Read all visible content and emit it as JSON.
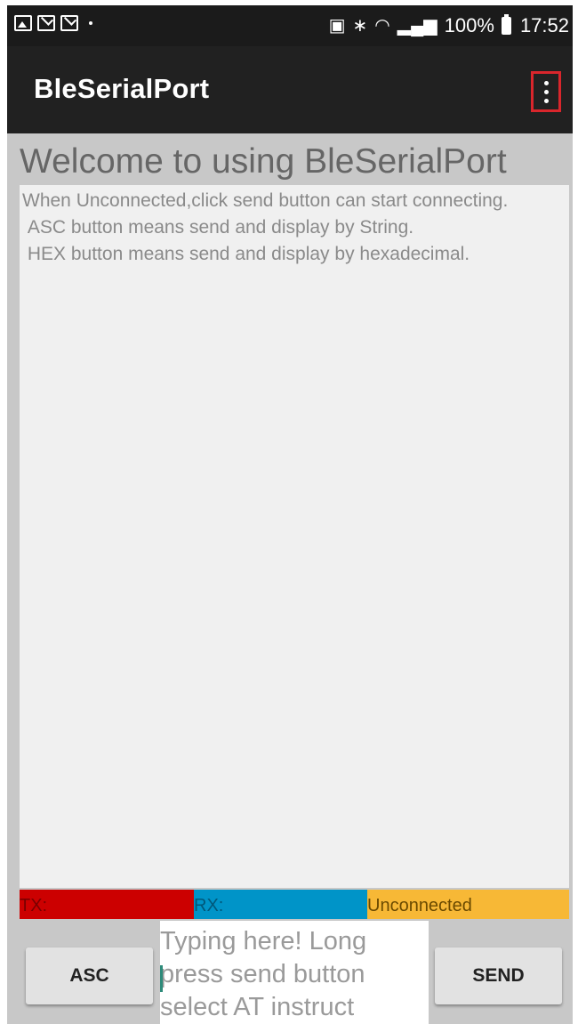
{
  "status_bar": {
    "battery": "100%",
    "time": "17:52",
    "icons": [
      "gallery-icon",
      "mail-icon",
      "mail-icon",
      "cast-icon",
      "bluetooth-icon",
      "wifi-icon",
      "signal-icon",
      "battery-icon"
    ]
  },
  "app_bar": {
    "title": "BleSerialPort",
    "overflow_icon": "more-vert-icon"
  },
  "main": {
    "welcome": "Welcome to using BleSerialPort",
    "log_lines": [
      "When Unconnected,click send button can start connecting.",
      " ASC button means send and display by String.",
      " HEX button means send and display by hexadecimal."
    ],
    "status": {
      "tx": "TX:",
      "rx": "RX:",
      "connection": "Unconnected"
    }
  },
  "controls": {
    "asc_label": "ASC",
    "send_label": "SEND",
    "input_placeholder": "Typing here! Long press send button select AT instruct"
  },
  "colors": {
    "app_bar": "#212121",
    "status_bar": "#1b1b1b",
    "content_bg": "#c8c8c8",
    "log_bg": "#f0f0f0",
    "tx": "#cc0000",
    "rx": "#0094c8",
    "connection": "#f7b836",
    "highlight": "#d9262c"
  }
}
